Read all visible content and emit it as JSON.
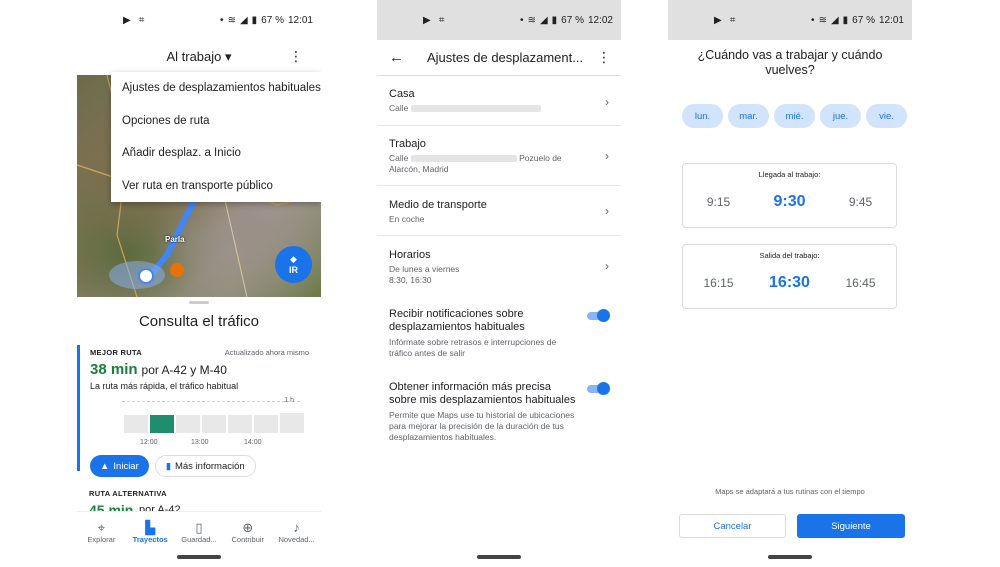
{
  "status": {
    "p1": {
      "battery": "67 %",
      "time": "12:01"
    },
    "p2": {
      "battery": "67 %",
      "time": "12:02"
    },
    "p3": {
      "battery": "67 %",
      "time": "12:01"
    }
  },
  "phone1": {
    "header_title": "Al trabajo",
    "menu": [
      "Ajustes de desplazamientos habituales",
      "Opciones de ruta",
      "Añadir desplaz. a Inicio",
      "Ver ruta en transporte público"
    ],
    "map_label": "Parla",
    "go_button": "IR",
    "sheet_title": "Consulta el tráfico",
    "best_route": {
      "label": "MEJOR RUTA",
      "updated": "Actualizado ahora mismo",
      "time": "38 min",
      "via": "por A-42 y M-40",
      "description": "La ruta más rápida, el tráfico habitual",
      "hour_label": "1 h",
      "ticks": [
        "12:00",
        "13:00",
        "14:00"
      ],
      "start_button": "Iniciar",
      "more_button": "Más información"
    },
    "alt_route": {
      "label": "RUTA ALTERNATIVA",
      "time": "45 min",
      "via": "por A-42"
    },
    "nav": [
      {
        "label": "Explorar",
        "icon": "pin-icon"
      },
      {
        "label": "Trayectos",
        "icon": "commute-icon"
      },
      {
        "label": "Guardad...",
        "icon": "bookmark-icon"
      },
      {
        "label": "Contribuir",
        "icon": "plus-icon"
      },
      {
        "label": "Novedad...",
        "icon": "bell-icon"
      }
    ]
  },
  "phone2": {
    "title": "Ajustes de desplazament...",
    "home": {
      "title": "Casa",
      "sub_prefix": "Calle"
    },
    "work": {
      "title": "Trabajo",
      "sub_prefix": "Calle",
      "sub_suffix": "Pozuelo de",
      "sub_line2": "Alarcón, Madrid"
    },
    "transport": {
      "title": "Medio de transporte",
      "sub": "En coche"
    },
    "schedule": {
      "title": "Horarios",
      "sub1": "De lunes a viernes",
      "sub2": "8:30, 16:30"
    },
    "notif": {
      "title": "Recibir notificaciones sobre desplazamientos habituales",
      "sub": "Infórmate sobre retrasos e interrupciones de tráfico antes de salir"
    },
    "precise": {
      "title": "Obtener información más precisa sobre mis desplazamientos habituales",
      "sub": "Permite que Maps use tu historial de ubicaciones para mejorar la precisión de la duración de tus desplazamientos habituales."
    }
  },
  "phone3": {
    "question": "¿Cuándo vas a trabajar y cuándo vuelves?",
    "days": [
      "lun.",
      "mar.",
      "mié.",
      "jue.",
      "vie."
    ],
    "arrival": {
      "label": "Llegada al trabajo:",
      "times": [
        "9:15",
        "9:30",
        "9:45"
      ]
    },
    "departure": {
      "label": "Salida del trabajo:",
      "times": [
        "16:15",
        "16:30",
        "16:45"
      ]
    },
    "note": "Maps se adaptará a tus rutinas con el tiempo",
    "cancel": "Cancelar",
    "next": "Siguiente"
  },
  "chart_data": {
    "type": "bar",
    "categories": [
      "",
      "12:00",
      "",
      "13:00",
      "",
      "14:00",
      ""
    ],
    "values": [
      0.47,
      0.47,
      0.47,
      0.47,
      0.47,
      0.47,
      0.53
    ],
    "highlight_index": 1,
    "colors": {
      "bar": "#e8e8e8",
      "highlight": "#1e8e6e"
    }
  }
}
